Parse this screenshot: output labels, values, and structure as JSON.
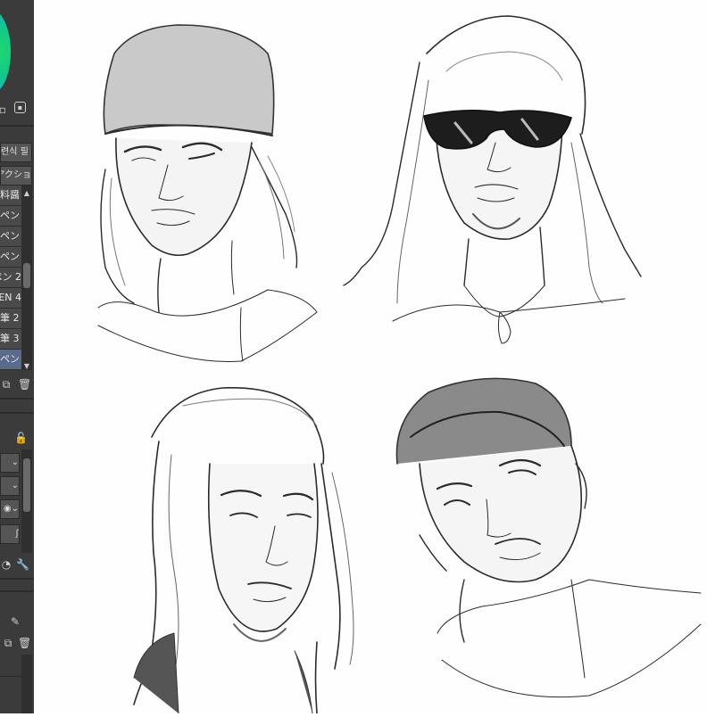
{
  "panel": {
    "tabs": [
      "련식 필",
      "アクショ"
    ],
    "brushes": [
      {
        "label": "料醤",
        "selected": false
      },
      {
        "label": "ペン",
        "selected": false
      },
      {
        "label": "ペン",
        "selected": false
      },
      {
        "label": "ペン",
        "selected": false
      },
      {
        "label": "ペン 2",
        "selected": false
      },
      {
        "label": "EN 4",
        "selected": false
      },
      {
        "label": "筆 2",
        "selected": false
      },
      {
        "label": "筆 3",
        "selected": false
      },
      {
        "label": "ペン",
        "selected": true
      }
    ],
    "colors": {
      "wheel_inner": "#1bd96a",
      "wheel_outer": "#0fb3c9",
      "panel_bg": "#3b3b3b",
      "selected_bg": "#5a6a8a"
    }
  },
  "canvas": {
    "subject": "four character portrait sketches",
    "portraits": [
      "winking-man-beanie",
      "man-sunglasses-dreadlocks",
      "man-dreadlocks-turned",
      "man-curly-hair-tilted"
    ]
  }
}
